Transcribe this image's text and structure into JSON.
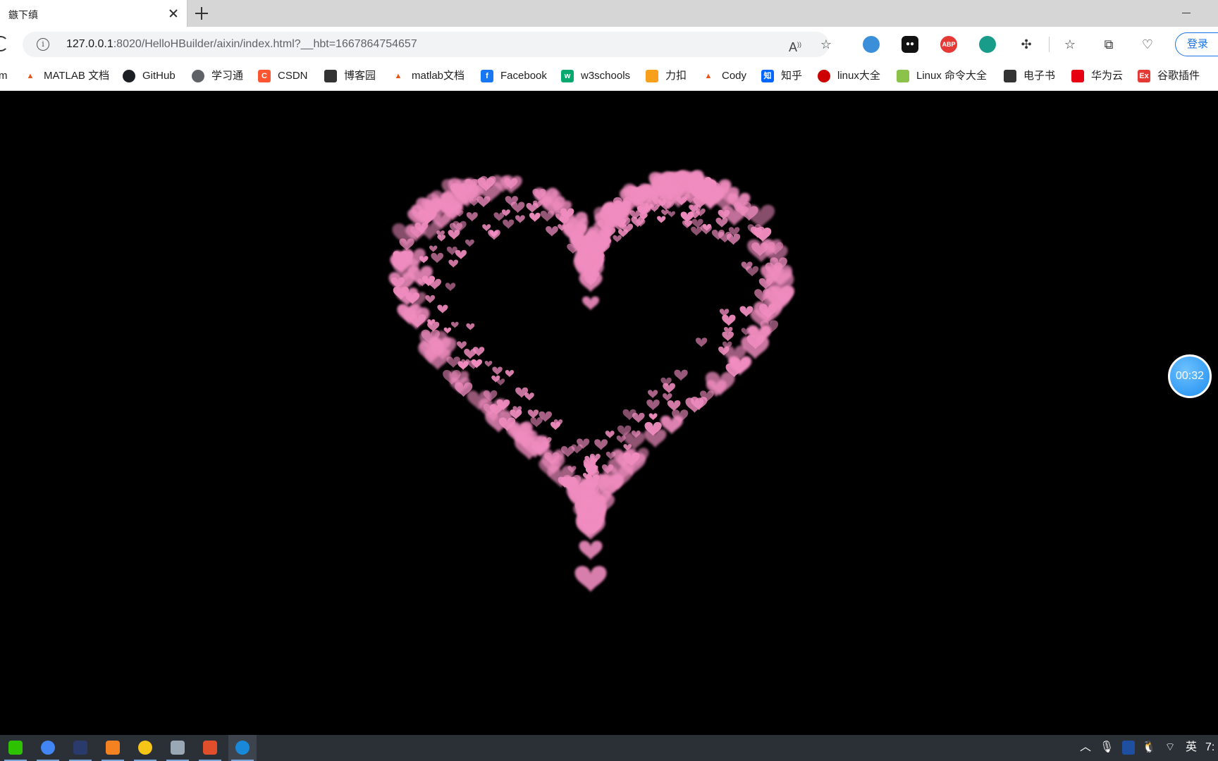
{
  "browser": {
    "tab": {
      "title": "鏃下缜"
    },
    "address": {
      "host": "127.0.0.1",
      "path": ":8020/HelloHBuilder/aixin/index.html?__hbt=1667864754657"
    },
    "login_label": "登录",
    "extensions": [
      {
        "name": "shield-extension",
        "label": ""
      },
      {
        "name": "tampermonkey-extension",
        "label": ""
      },
      {
        "name": "adblock-plus-extension",
        "label": "ABP"
      },
      {
        "name": "green-extension",
        "label": ""
      }
    ]
  },
  "bookmarks": [
    {
      "label": "m",
      "icon": ""
    },
    {
      "label": "MATLAB 文档",
      "icon": "matlab-icon",
      "color": "#e4561b"
    },
    {
      "label": "GitHub",
      "icon": "github-icon",
      "color": "#1b1f23"
    },
    {
      "label": "学习通",
      "icon": "globe-icon",
      "color": "#5f6368"
    },
    {
      "label": "CSDN",
      "icon": "csdn-icon",
      "color": "#fc5531",
      "glyph": "C"
    },
    {
      "label": "博客园",
      "icon": "cnblogs-icon",
      "color": "#333333"
    },
    {
      "label": "matlab文档",
      "icon": "matlab-icon",
      "color": "#e4561b"
    },
    {
      "label": "Facebook",
      "icon": "facebook-icon",
      "color": "#1877f2",
      "glyph": "f"
    },
    {
      "label": "w3schools",
      "icon": "w3schools-icon",
      "color": "#04aa6d",
      "glyph": "w"
    },
    {
      "label": "力扣",
      "icon": "leetcode-icon",
      "color": "#f89f1b"
    },
    {
      "label": "Cody",
      "icon": "matlab-icon",
      "color": "#e4561b"
    },
    {
      "label": "知乎",
      "icon": "zhihu-icon",
      "color": "#0066ff",
      "glyph": "知"
    },
    {
      "label": "linux大全",
      "icon": "redhat-icon",
      "color": "#cc0000"
    },
    {
      "label": "Linux 命令大全",
      "icon": "linux-icon",
      "color": "#8bc34a"
    },
    {
      "label": "电子书",
      "icon": "ebook-icon",
      "color": "#333333"
    },
    {
      "label": "华为云",
      "icon": "huawei-icon",
      "color": "#e60012"
    },
    {
      "label": "谷歌插件",
      "icon": "ex-icon",
      "color": "#e53935",
      "glyph": "Ex"
    }
  ],
  "page": {
    "background": "#000000",
    "heart_color": "#f08cbf",
    "timer_text": "00:32"
  },
  "taskbar": {
    "apps": [
      {
        "name": "wechat",
        "color": "#2dc100"
      },
      {
        "name": "chrome",
        "color": "#4285f4"
      },
      {
        "name": "app-dark",
        "color": "#2a3a6a"
      },
      {
        "name": "eclipse-like",
        "color": "#f58220"
      },
      {
        "name": "app-yellow",
        "color": "#f5c518"
      },
      {
        "name": "app-bird",
        "color": "#9aa7b5"
      },
      {
        "name": "hbuilder",
        "color": "#e04e2c"
      },
      {
        "name": "edge",
        "color": "#1a88d8"
      }
    ],
    "ime_label": "英",
    "clock_partial": "7:"
  }
}
